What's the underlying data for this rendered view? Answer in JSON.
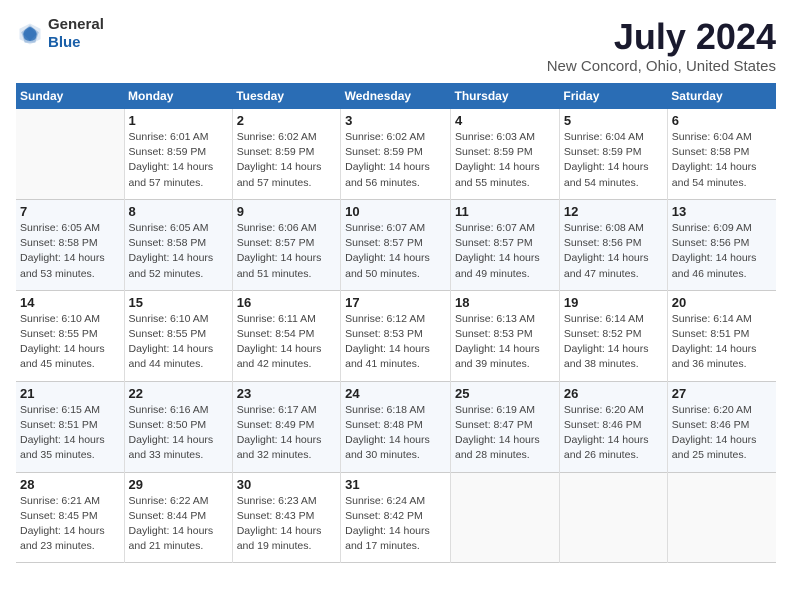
{
  "logo": {
    "general": "General",
    "blue": "Blue"
  },
  "title": "July 2024",
  "subtitle": "New Concord, Ohio, United States",
  "days_header": [
    "Sunday",
    "Monday",
    "Tuesday",
    "Wednesday",
    "Thursday",
    "Friday",
    "Saturday"
  ],
  "weeks": [
    [
      {
        "day": "",
        "info": ""
      },
      {
        "day": "1",
        "info": "Sunrise: 6:01 AM\nSunset: 8:59 PM\nDaylight: 14 hours\nand 57 minutes."
      },
      {
        "day": "2",
        "info": "Sunrise: 6:02 AM\nSunset: 8:59 PM\nDaylight: 14 hours\nand 57 minutes."
      },
      {
        "day": "3",
        "info": "Sunrise: 6:02 AM\nSunset: 8:59 PM\nDaylight: 14 hours\nand 56 minutes."
      },
      {
        "day": "4",
        "info": "Sunrise: 6:03 AM\nSunset: 8:59 PM\nDaylight: 14 hours\nand 55 minutes."
      },
      {
        "day": "5",
        "info": "Sunrise: 6:04 AM\nSunset: 8:59 PM\nDaylight: 14 hours\nand 54 minutes."
      },
      {
        "day": "6",
        "info": "Sunrise: 6:04 AM\nSunset: 8:58 PM\nDaylight: 14 hours\nand 54 minutes."
      }
    ],
    [
      {
        "day": "7",
        "info": "Sunrise: 6:05 AM\nSunset: 8:58 PM\nDaylight: 14 hours\nand 53 minutes."
      },
      {
        "day": "8",
        "info": "Sunrise: 6:05 AM\nSunset: 8:58 PM\nDaylight: 14 hours\nand 52 minutes."
      },
      {
        "day": "9",
        "info": "Sunrise: 6:06 AM\nSunset: 8:57 PM\nDaylight: 14 hours\nand 51 minutes."
      },
      {
        "day": "10",
        "info": "Sunrise: 6:07 AM\nSunset: 8:57 PM\nDaylight: 14 hours\nand 50 minutes."
      },
      {
        "day": "11",
        "info": "Sunrise: 6:07 AM\nSunset: 8:57 PM\nDaylight: 14 hours\nand 49 minutes."
      },
      {
        "day": "12",
        "info": "Sunrise: 6:08 AM\nSunset: 8:56 PM\nDaylight: 14 hours\nand 47 minutes."
      },
      {
        "day": "13",
        "info": "Sunrise: 6:09 AM\nSunset: 8:56 PM\nDaylight: 14 hours\nand 46 minutes."
      }
    ],
    [
      {
        "day": "14",
        "info": "Sunrise: 6:10 AM\nSunset: 8:55 PM\nDaylight: 14 hours\nand 45 minutes."
      },
      {
        "day": "15",
        "info": "Sunrise: 6:10 AM\nSunset: 8:55 PM\nDaylight: 14 hours\nand 44 minutes."
      },
      {
        "day": "16",
        "info": "Sunrise: 6:11 AM\nSunset: 8:54 PM\nDaylight: 14 hours\nand 42 minutes."
      },
      {
        "day": "17",
        "info": "Sunrise: 6:12 AM\nSunset: 8:53 PM\nDaylight: 14 hours\nand 41 minutes."
      },
      {
        "day": "18",
        "info": "Sunrise: 6:13 AM\nSunset: 8:53 PM\nDaylight: 14 hours\nand 39 minutes."
      },
      {
        "day": "19",
        "info": "Sunrise: 6:14 AM\nSunset: 8:52 PM\nDaylight: 14 hours\nand 38 minutes."
      },
      {
        "day": "20",
        "info": "Sunrise: 6:14 AM\nSunset: 8:51 PM\nDaylight: 14 hours\nand 36 minutes."
      }
    ],
    [
      {
        "day": "21",
        "info": "Sunrise: 6:15 AM\nSunset: 8:51 PM\nDaylight: 14 hours\nand 35 minutes."
      },
      {
        "day": "22",
        "info": "Sunrise: 6:16 AM\nSunset: 8:50 PM\nDaylight: 14 hours\nand 33 minutes."
      },
      {
        "day": "23",
        "info": "Sunrise: 6:17 AM\nSunset: 8:49 PM\nDaylight: 14 hours\nand 32 minutes."
      },
      {
        "day": "24",
        "info": "Sunrise: 6:18 AM\nSunset: 8:48 PM\nDaylight: 14 hours\nand 30 minutes."
      },
      {
        "day": "25",
        "info": "Sunrise: 6:19 AM\nSunset: 8:47 PM\nDaylight: 14 hours\nand 28 minutes."
      },
      {
        "day": "26",
        "info": "Sunrise: 6:20 AM\nSunset: 8:46 PM\nDaylight: 14 hours\nand 26 minutes."
      },
      {
        "day": "27",
        "info": "Sunrise: 6:20 AM\nSunset: 8:46 PM\nDaylight: 14 hours\nand 25 minutes."
      }
    ],
    [
      {
        "day": "28",
        "info": "Sunrise: 6:21 AM\nSunset: 8:45 PM\nDaylight: 14 hours\nand 23 minutes."
      },
      {
        "day": "29",
        "info": "Sunrise: 6:22 AM\nSunset: 8:44 PM\nDaylight: 14 hours\nand 21 minutes."
      },
      {
        "day": "30",
        "info": "Sunrise: 6:23 AM\nSunset: 8:43 PM\nDaylight: 14 hours\nand 19 minutes."
      },
      {
        "day": "31",
        "info": "Sunrise: 6:24 AM\nSunset: 8:42 PM\nDaylight: 14 hours\nand 17 minutes."
      },
      {
        "day": "",
        "info": ""
      },
      {
        "day": "",
        "info": ""
      },
      {
        "day": "",
        "info": ""
      }
    ]
  ]
}
